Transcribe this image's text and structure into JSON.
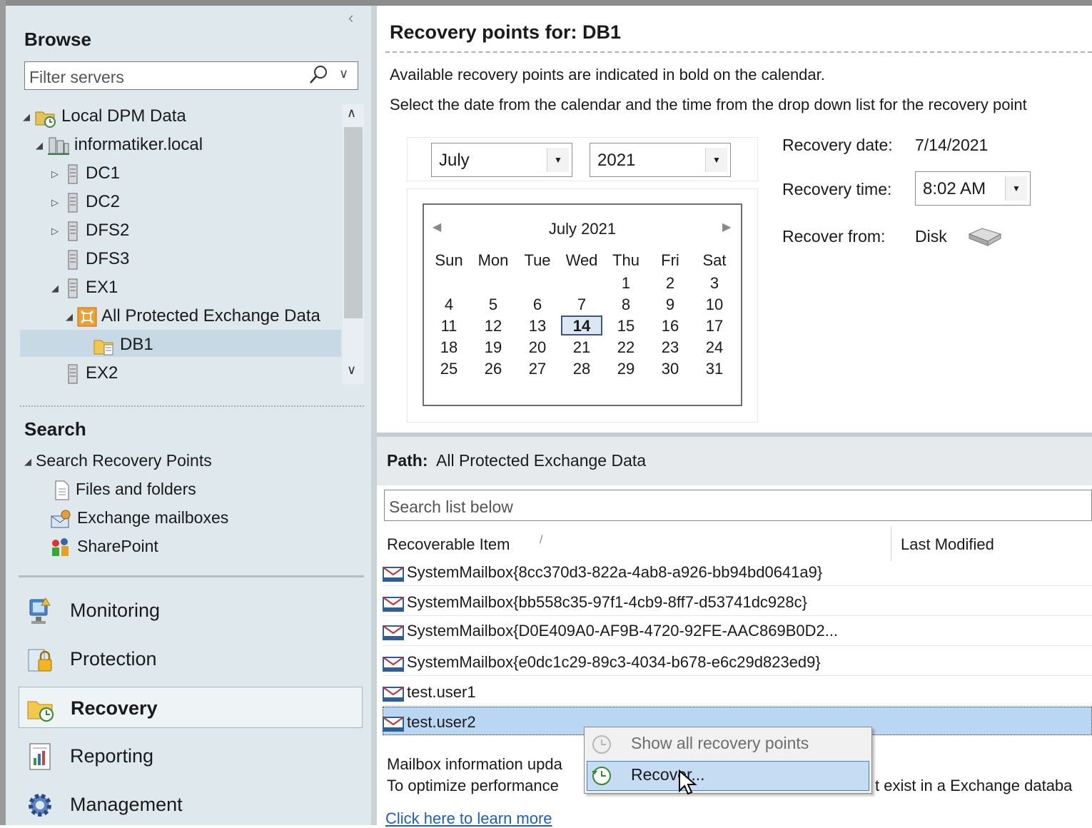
{
  "browse": {
    "title": "Browse",
    "filter_placeholder": "Filter servers",
    "tree": [
      {
        "label": "Local DPM Data"
      },
      {
        "label": "informatiker.local"
      },
      {
        "label": "DC1"
      },
      {
        "label": "DC2"
      },
      {
        "label": "DFS2"
      },
      {
        "label": "DFS3"
      },
      {
        "label": "EX1"
      },
      {
        "label": "All Protected Exchange Data"
      },
      {
        "label": "DB1"
      },
      {
        "label": "EX2"
      }
    ]
  },
  "search": {
    "title": "Search",
    "root": "Search Recovery Points",
    "items": [
      "Files and folders",
      "Exchange mailboxes",
      "SharePoint"
    ]
  },
  "nav": [
    "Monitoring",
    "Protection",
    "Recovery",
    "Reporting",
    "Management"
  ],
  "recovery": {
    "title": "Recovery points for:  DB1",
    "instruction1": "Available recovery points are indicated in bold on the calendar.",
    "instruction2": "Select the date from the calendar and the time from the drop down list for the recovery point",
    "month": "July",
    "year": "2021",
    "calendar": {
      "header": "July 2021",
      "days": [
        "Sun",
        "Mon",
        "Tue",
        "Wed",
        "Thu",
        "Fri",
        "Sat"
      ],
      "weeks": [
        [
          "",
          "",
          "",
          "",
          "1",
          "2",
          "3"
        ],
        [
          "4",
          "5",
          "6",
          "7",
          "8",
          "9",
          "10"
        ],
        [
          "11",
          "12",
          "13",
          "14",
          "15",
          "16",
          "17"
        ],
        [
          "18",
          "19",
          "20",
          "21",
          "22",
          "23",
          "24"
        ],
        [
          "25",
          "26",
          "27",
          "28",
          "29",
          "30",
          "31"
        ]
      ],
      "selected": "14"
    },
    "date_label": "Recovery date:",
    "date_value": "7/14/2021",
    "time_label": "Recovery time:",
    "time_value": "8:02 AM",
    "from_label": "Recover from:",
    "from_value": "Disk"
  },
  "path": {
    "label": "Path:",
    "value": "All Protected Exchange Data"
  },
  "list": {
    "search_placeholder": "Search list below",
    "col_item": "Recoverable Item",
    "col_sort": "/",
    "col_modified": "Last Modified",
    "rows": [
      "SystemMailbox{8cc370d3-822a-4ab8-a926-bb94bd0641a9}",
      "SystemMailbox{bb558c35-97f1-4cb9-8ff7-d53741dc928c}",
      "SystemMailbox{D0E409A0-AF9B-4720-92FE-AAC869B0D2...",
      "SystemMailbox{e0dc1c29-89c3-4034-b678-e6c29d823ed9}",
      "test.user1",
      "test.user2"
    ]
  },
  "footer": {
    "line1": "Mailbox information upda",
    "line2": "To optimize performance",
    "line2_tail": "t exist in a Exchange databa",
    "link": "Click here to learn more"
  },
  "context_menu": {
    "items": [
      "Show all recovery points",
      "Recover..."
    ]
  }
}
